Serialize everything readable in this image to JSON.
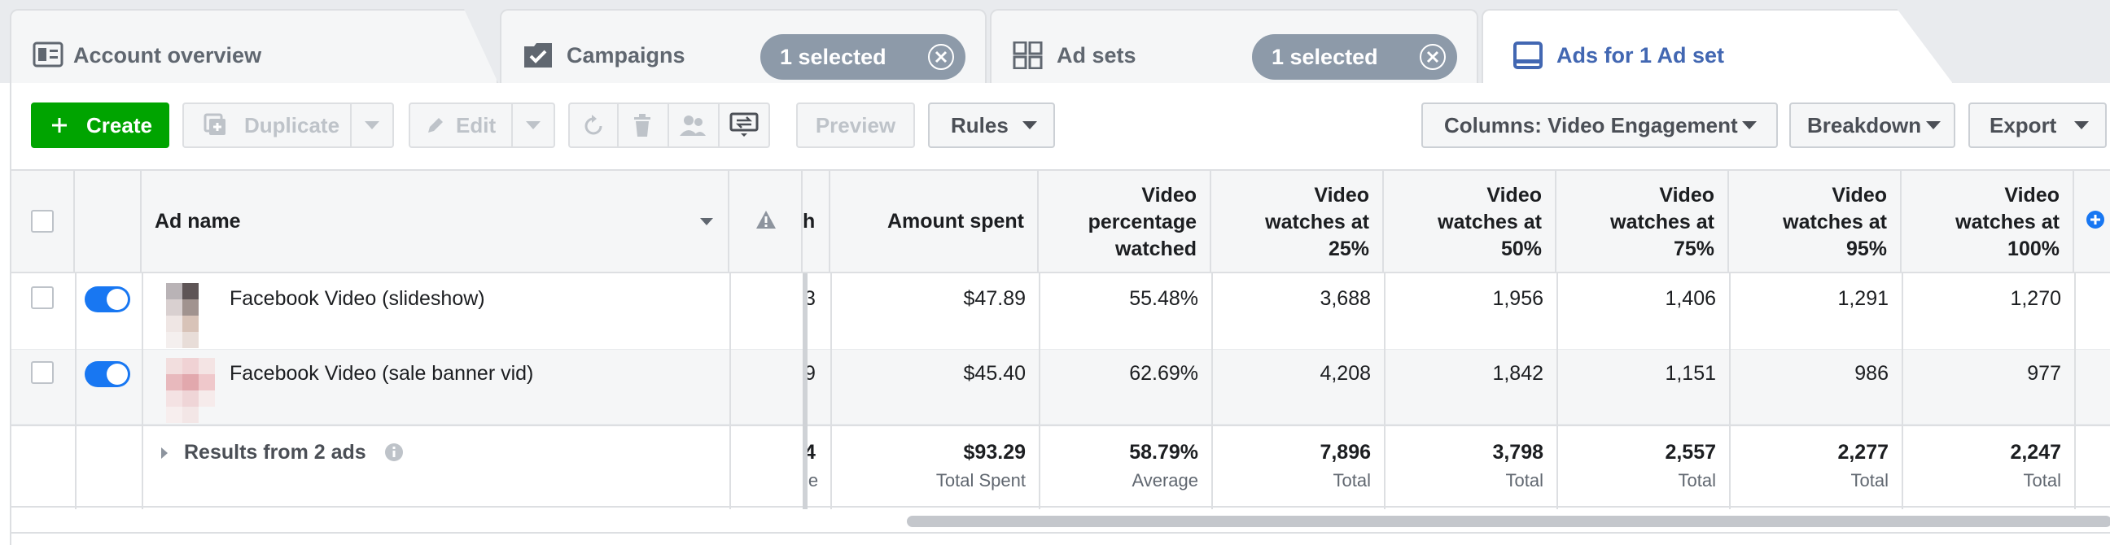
{
  "tabs": [
    {
      "label": "Account overview",
      "icon": "dashboard-icon"
    },
    {
      "label": "Campaigns",
      "icon": "folder-check-icon",
      "pill": "1 selected"
    },
    {
      "label": "Ad sets",
      "icon": "grid-icon",
      "pill": "1 selected"
    },
    {
      "label": "Ads for 1 Ad set",
      "icon": "ad-icon",
      "active": true
    }
  ],
  "toolbar": {
    "create": "Create",
    "duplicate": "Duplicate",
    "edit": "Edit",
    "preview": "Preview",
    "rules": "Rules",
    "columns": "Columns: Video Engagement",
    "breakdown": "Breakdown",
    "export": "Export"
  },
  "table": {
    "headers": {
      "ad_name": "Ad name",
      "reach_fragment": "h",
      "amount_spent": "Amount spent",
      "video_percentage": [
        "Video",
        "percentage",
        "watched"
      ],
      "v25": [
        "Video",
        "watches at",
        "25%"
      ],
      "v50": [
        "Video",
        "watches at",
        "50%"
      ],
      "v75": [
        "Video",
        "watches at",
        "75%"
      ],
      "v95": [
        "Video",
        "watches at",
        "95%"
      ],
      "v100": [
        "Video",
        "watches at",
        "100%"
      ]
    },
    "rows": [
      {
        "name": "Facebook Video (slideshow)",
        "reach": "3",
        "spent": "$47.89",
        "pct": "55.48%",
        "v25": "3,688",
        "v50": "1,956",
        "v75": "1,406",
        "v95": "1,291",
        "v100": "1,270"
      },
      {
        "name": "Facebook Video (sale banner vid)",
        "reach": "9",
        "spent": "$45.40",
        "pct": "62.69%",
        "v25": "4,208",
        "v50": "1,842",
        "v75": "1,151",
        "v95": "986",
        "v100": "977"
      }
    ],
    "totals": {
      "label": "Results from 2 ads",
      "reach": "4",
      "reach_sub": "le",
      "spent": "$93.29",
      "spent_sub": "Total Spent",
      "pct": "58.79%",
      "pct_sub": "Average",
      "v25": "7,896",
      "v50": "3,798",
      "v75": "2,557",
      "v95": "2,277",
      "v100": "2,247",
      "total_sub": "Total"
    }
  },
  "colors": {
    "accent": "#4267b2",
    "create": "#00a400",
    "pill": "#8d9aa9",
    "toggle": "#1877f2"
  }
}
